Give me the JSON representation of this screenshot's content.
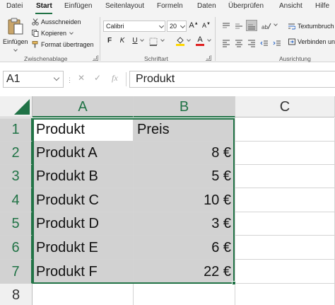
{
  "ribbon_tabs": [
    "Datei",
    "Start",
    "Einfügen",
    "Seitenlayout",
    "Formeln",
    "Daten",
    "Überprüfen",
    "Ansicht",
    "Hilfe"
  ],
  "clipboard": {
    "paste_label": "Einfügen",
    "cut_label": "Ausschneiden",
    "copy_label": "Kopieren",
    "format_painter_label": "Format übertragen",
    "group_label": "Zwischenablage"
  },
  "font": {
    "name": "Calibri",
    "size": "20",
    "bold": "F",
    "italic": "K",
    "underline": "U",
    "group_label": "Schriftart"
  },
  "alignment": {
    "wrap_text_label": "Textumbruch",
    "merge_label": "Verbinden und",
    "group_label": "Ausrichtung"
  },
  "formula_bar": {
    "name_box": "A1",
    "cancel_icon": "✕",
    "enter_icon": "✓",
    "fx_label": "fx",
    "content": "Produkt"
  },
  "columns": [
    "A",
    "B",
    "C"
  ],
  "rows": [
    {
      "num": "1",
      "a": "Produkt",
      "b": "Preis"
    },
    {
      "num": "2",
      "a": "Produkt A",
      "b": "8 €"
    },
    {
      "num": "3",
      "a": "Produkt B",
      "b": "5 €"
    },
    {
      "num": "4",
      "a": "Produkt C",
      "b": "10 €"
    },
    {
      "num": "5",
      "a": "Produkt D",
      "b": "3 €"
    },
    {
      "num": "6",
      "a": "Produkt E",
      "b": "6 €"
    },
    {
      "num": "7",
      "a": "Produkt F",
      "b": "22 €"
    },
    {
      "num": "8",
      "a": "",
      "b": ""
    }
  ],
  "colors": {
    "accent": "#217346",
    "selection_fill": "#d2d2d2"
  }
}
